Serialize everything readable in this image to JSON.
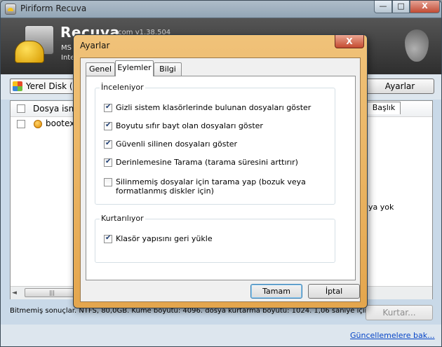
{
  "window": {
    "title": "Piriform Recuva",
    "min_glyph": "—",
    "max_glyph": "□",
    "close_glyph": "X"
  },
  "header": {
    "brand": "Recuva",
    "brand_suffix": ".com   v1.38.504",
    "line1": "MS",
    "line2": "Inte"
  },
  "toolbar": {
    "drive_label": "Yerel Disk (C:)",
    "options_label": "Ayarlar"
  },
  "list": {
    "column_filename": "Dosya ismi",
    "rows": [
      {
        "name": "bootex.l"
      }
    ],
    "info_tab": "Başlık",
    "info_text": "ya yok",
    "scroll_thumb": "|||",
    "scroll_left": "◄",
    "scroll_right": "►"
  },
  "status": {
    "text": "Bitmemiş sonuçlar. NTFS, 80,0GB. Küme boyutu: 4096. dosya kurtarma boyutu: 1024. 1,06 saniye içinde"
  },
  "recover_button": "Kurtar...",
  "footer": {
    "update_link": "Güncellemelere bak..."
  },
  "dialog": {
    "title": "Ayarlar",
    "close_glyph": "X",
    "tabs": [
      "Genel",
      "Eylemler",
      "Bilgi"
    ],
    "scan_group": {
      "legend": "İnceleniyor",
      "options": [
        {
          "label": "Gizli sistem klasörlerinde bulunan dosyaları göster",
          "checked": true
        },
        {
          "label": "Boyutu sıfır bayt olan dosyaları göster",
          "checked": true
        },
        {
          "label": "Güvenli silinen dosyaları göster",
          "checked": true
        },
        {
          "label": "Derinlemesine Tarama (tarama süresini arttırır)",
          "checked": true
        },
        {
          "label": "Silinmemiş dosyalar için tarama yap (bozuk veya formatlanmış diskler için)",
          "checked": false
        }
      ]
    },
    "recover_group": {
      "legend": "Kurtarılıyor",
      "options": [
        {
          "label": "Klasör yapısını geri yükle",
          "checked": true
        }
      ]
    },
    "ok_label": "Tamam",
    "cancel_label": "İptal"
  }
}
